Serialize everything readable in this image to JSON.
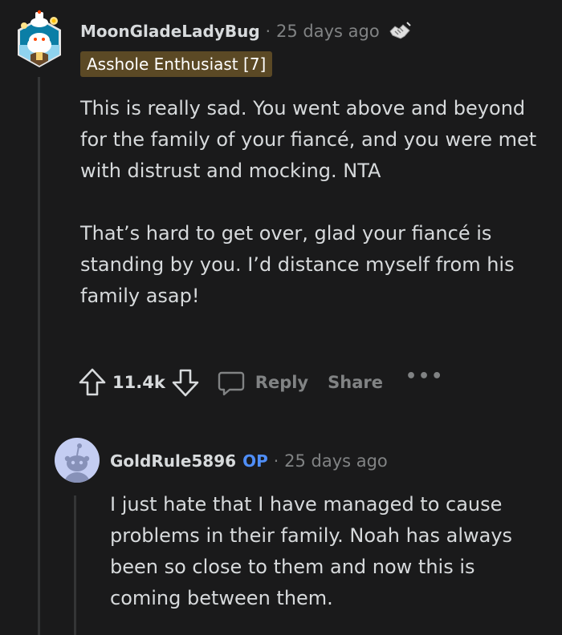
{
  "comment1": {
    "username": "MoonGladeLadyBug",
    "time": "25 days ago",
    "flair": "Asshole Enthusiast [7]",
    "paragraphs": [
      "This is really sad. You went above and beyond for the family of your fiancé, and you were met with distrust and mocking. NTA",
      "That’s hard to get over, glad your fiancé is standing by you. I’d distance myself from his family asap!"
    ],
    "actions": {
      "vote_count": "11.4k",
      "reply_label": "Reply",
      "share_label": "Share",
      "more_label": "•••"
    },
    "award_icon": "handshake-award-icon"
  },
  "comment2": {
    "username": "GoldRule5896",
    "op_label": "OP",
    "time": "25 days ago",
    "body": "I just hate that I have managed to cause problems in their family. Noah has always been so close to them and now this is coming between them."
  },
  "separator": "·",
  "colors": {
    "background": "#1a1a1b",
    "text": "#d7dadc",
    "muted": "#818384",
    "op": "#4f8ef7",
    "flair_bg": "#5b4925",
    "thread_line": "#343536"
  }
}
